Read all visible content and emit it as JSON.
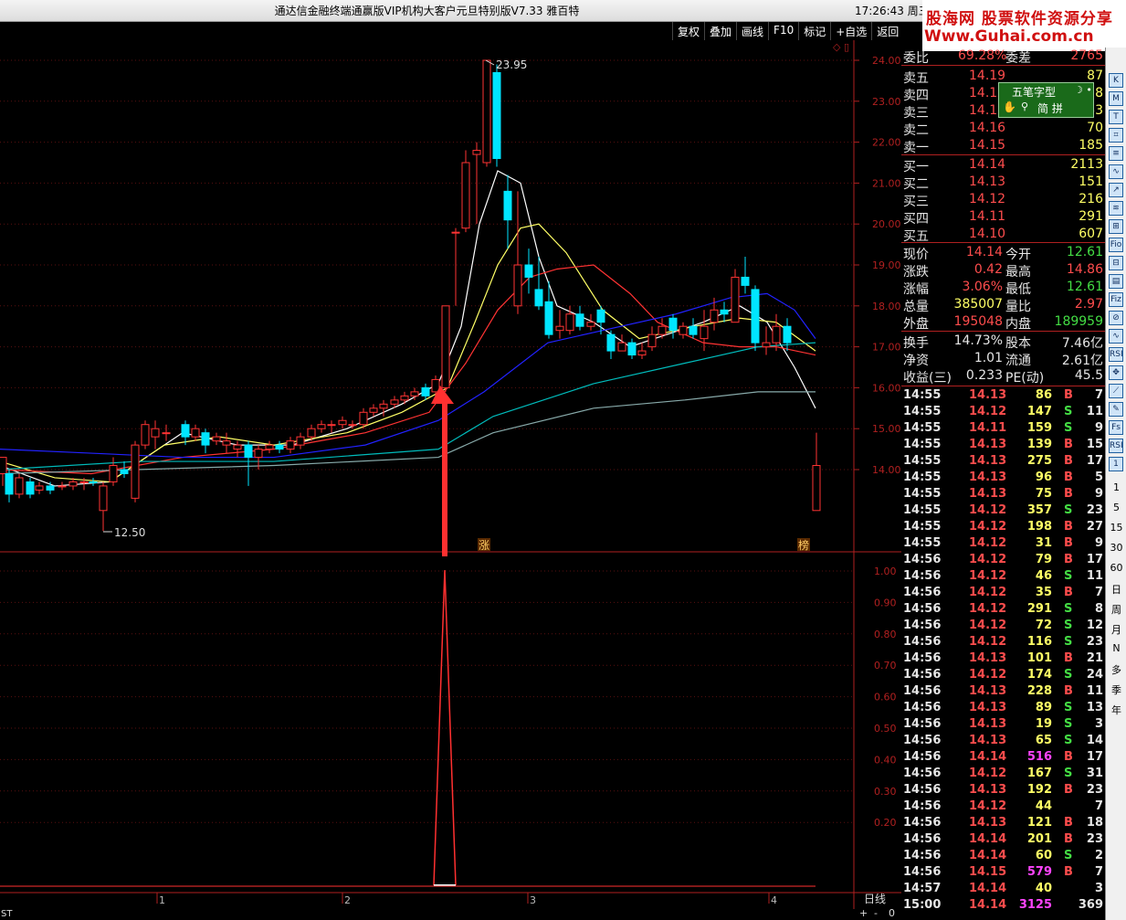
{
  "window": {
    "title": "通达信金融终端通赢版VIP机构大客户元旦特别版V7.33    雅百特",
    "clock": "17:26:43 周三",
    "logo_line1": "股海网 股票软件资源分享",
    "logo_line2": "Www.Guhai.com.cn"
  },
  "toolbar": [
    "复权",
    "叠加",
    "画线",
    "F10",
    "标记",
    "+自选",
    "返回"
  ],
  "chart": {
    "price_axis": [
      "24.00",
      "23.00",
      "22.00",
      "21.00",
      "20.00",
      "19.00",
      "18.00",
      "17.00",
      "16.00",
      "15.00",
      "14.00"
    ],
    "indicator_axis": [
      "1.00",
      "0.90",
      "0.80",
      "0.70",
      "0.60",
      "0.50",
      "0.40",
      "0.30",
      "0.20"
    ],
    "time_axis": [
      "1",
      "2",
      "3",
      "4"
    ],
    "high_label": "23.95",
    "low_label": "12.50",
    "marker_zhang": "涨",
    "marker_bang": "榜",
    "period_label": "日线",
    "status_left": "ST",
    "zoom_plus": "+",
    "zoom_minus": "-",
    "zoom_zero": "0",
    "colors": {
      "up": "#ff3333",
      "down": "#00e5ff",
      "ma5": "#ffffff",
      "ma10": "#ffff66",
      "ma20": "#ff3333",
      "ma60": "#2222ff",
      "ma_long1": "#00bbbb",
      "ma_long2": "#88aaaa"
    }
  },
  "ime": {
    "name": "五笔字型",
    "row2": "简 拼"
  },
  "quote": {
    "weibi": {
      "label": "委比",
      "value": "69.28%",
      "label2": "委差",
      "value2": "2765"
    },
    "asks": [
      {
        "label": "卖五",
        "price": "14.19",
        "vol": "87"
      },
      {
        "label": "卖四",
        "price": "14.18",
        "vol": "8"
      },
      {
        "label": "卖三",
        "price": "14.17",
        "vol": "63"
      },
      {
        "label": "卖二",
        "price": "14.16",
        "vol": "70"
      },
      {
        "label": "卖一",
        "price": "14.15",
        "vol": "185"
      }
    ],
    "bids": [
      {
        "label": "买一",
        "price": "14.14",
        "vol": "2113"
      },
      {
        "label": "买二",
        "price": "14.13",
        "vol": "151"
      },
      {
        "label": "买三",
        "price": "14.12",
        "vol": "216"
      },
      {
        "label": "买四",
        "price": "14.11",
        "vol": "291"
      },
      {
        "label": "买五",
        "price": "14.10",
        "vol": "607"
      }
    ],
    "stats": [
      {
        "l1": "现价",
        "v1": "14.14",
        "c1": "red",
        "l2": "今开",
        "v2": "12.61",
        "c2": "green"
      },
      {
        "l1": "涨跌",
        "v1": "0.42",
        "c1": "red",
        "l2": "最高",
        "v2": "14.86",
        "c2": "red"
      },
      {
        "l1": "涨幅",
        "v1": "3.06%",
        "c1": "red",
        "l2": "最低",
        "v2": "12.61",
        "c2": "green"
      },
      {
        "l1": "总量",
        "v1": "385007",
        "c1": "yel",
        "l2": "量比",
        "v2": "2.97",
        "c2": "red"
      },
      {
        "l1": "外盘",
        "v1": "195048",
        "c1": "red",
        "l2": "内盘",
        "v2": "189959",
        "c2": "green"
      }
    ],
    "fund": [
      {
        "l1": "换手",
        "v1": "14.73%",
        "l2": "股本",
        "v2": "7.46亿"
      },
      {
        "l1": "净资",
        "v1": "1.01",
        "l2": "流通",
        "v2": "2.61亿"
      },
      {
        "l1": "收益(三)",
        "v1": "0.233",
        "l2": "PE(动)",
        "v2": "45.5"
      }
    ]
  },
  "ticks": [
    [
      "14:55",
      "14.13",
      "86",
      "B",
      "7"
    ],
    [
      "14:55",
      "14.12",
      "147",
      "S",
      "11"
    ],
    [
      "14:55",
      "14.11",
      "159",
      "S",
      "9"
    ],
    [
      "14:55",
      "14.13",
      "139",
      "B",
      "15"
    ],
    [
      "14:55",
      "14.13",
      "275",
      "B",
      "17"
    ],
    [
      "14:55",
      "14.13",
      "96",
      "B",
      "5"
    ],
    [
      "14:55",
      "14.13",
      "75",
      "B",
      "9"
    ],
    [
      "14:55",
      "14.12",
      "357",
      "S",
      "23"
    ],
    [
      "14:55",
      "14.12",
      "198",
      "B",
      "27"
    ],
    [
      "14:55",
      "14.12",
      "31",
      "B",
      "9"
    ],
    [
      "14:56",
      "14.12",
      "79",
      "B",
      "17"
    ],
    [
      "14:56",
      "14.12",
      "46",
      "S",
      "11"
    ],
    [
      "14:56",
      "14.12",
      "35",
      "B",
      "7"
    ],
    [
      "14:56",
      "14.12",
      "291",
      "S",
      "8"
    ],
    [
      "14:56",
      "14.12",
      "72",
      "S",
      "12"
    ],
    [
      "14:56",
      "14.12",
      "116",
      "S",
      "23"
    ],
    [
      "14:56",
      "14.13",
      "101",
      "B",
      "21"
    ],
    [
      "14:56",
      "14.12",
      "174",
      "S",
      "24"
    ],
    [
      "14:56",
      "14.13",
      "228",
      "B",
      "11"
    ],
    [
      "14:56",
      "14.13",
      "89",
      "S",
      "13"
    ],
    [
      "14:56",
      "14.13",
      "19",
      "S",
      "3"
    ],
    [
      "14:56",
      "14.13",
      "65",
      "S",
      "14"
    ],
    [
      "14:56",
      "14.14",
      "516",
      "B",
      "17"
    ],
    [
      "14:56",
      "14.12",
      "167",
      "S",
      "31"
    ],
    [
      "14:56",
      "14.13",
      "192",
      "B",
      "23"
    ],
    [
      "14:56",
      "14.12",
      "44",
      "",
      "7"
    ],
    [
      "14:56",
      "14.13",
      "121",
      "B",
      "18"
    ],
    [
      "14:56",
      "14.14",
      "201",
      "B",
      "23"
    ],
    [
      "14:56",
      "14.14",
      "60",
      "S",
      "2"
    ],
    [
      "14:56",
      "14.15",
      "579",
      "B",
      "7"
    ],
    [
      "14:57",
      "14.14",
      "40",
      "",
      "3"
    ],
    [
      "15:00",
      "14.14",
      "3125",
      "",
      "369"
    ]
  ],
  "side": [
    "1",
    "5",
    "15",
    "30",
    "60",
    "日",
    "周",
    "月",
    "N",
    "多",
    "季",
    "年"
  ],
  "side_icons": [
    "K",
    "M",
    "T",
    "⌗",
    "≡",
    "∿",
    "↗",
    "≋",
    "⊞",
    "Fio",
    "⊟",
    "▤",
    "Fiz",
    "⊘",
    "∿",
    "RSI",
    "✥",
    "⟋",
    "✎",
    "Fs",
    "RSI",
    "1"
  ]
}
